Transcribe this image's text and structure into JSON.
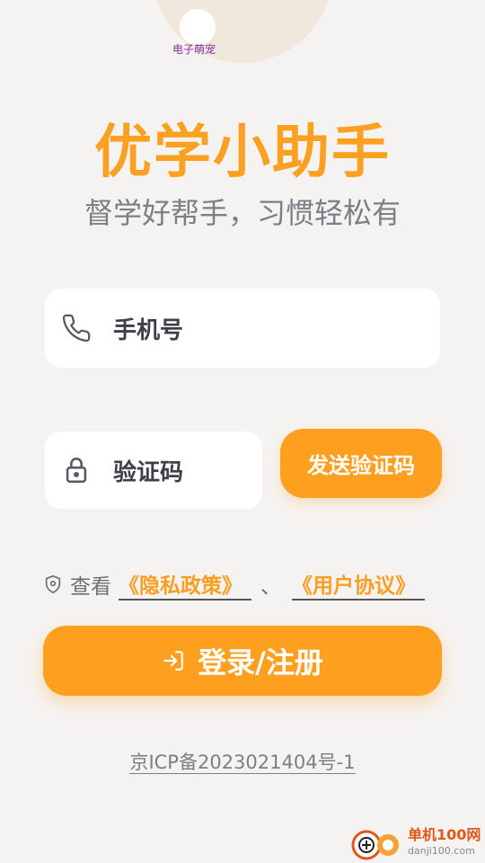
{
  "header": {
    "pet_label": "电子萌宠",
    "title": "优学小助手",
    "subtitle": "督学好帮手，习惯轻松有"
  },
  "form": {
    "phone_placeholder": "手机号",
    "code_placeholder": "验证码",
    "send_code_label": "发送验证码"
  },
  "agreement": {
    "prefix": "查看",
    "privacy_link": "《隐私政策》",
    "separator": "、",
    "terms_link": "《用户协议》"
  },
  "login_button_label": "登录/注册",
  "icp": "京ICP备2023021404号-1",
  "watermark": {
    "name": "单机100网",
    "url": "danji100.com"
  },
  "colors": {
    "accent": "#ff9f1f",
    "background": "#f5f3f1"
  },
  "icons": [
    "phone-icon",
    "lock-icon",
    "shield-icon",
    "login-icon"
  ]
}
